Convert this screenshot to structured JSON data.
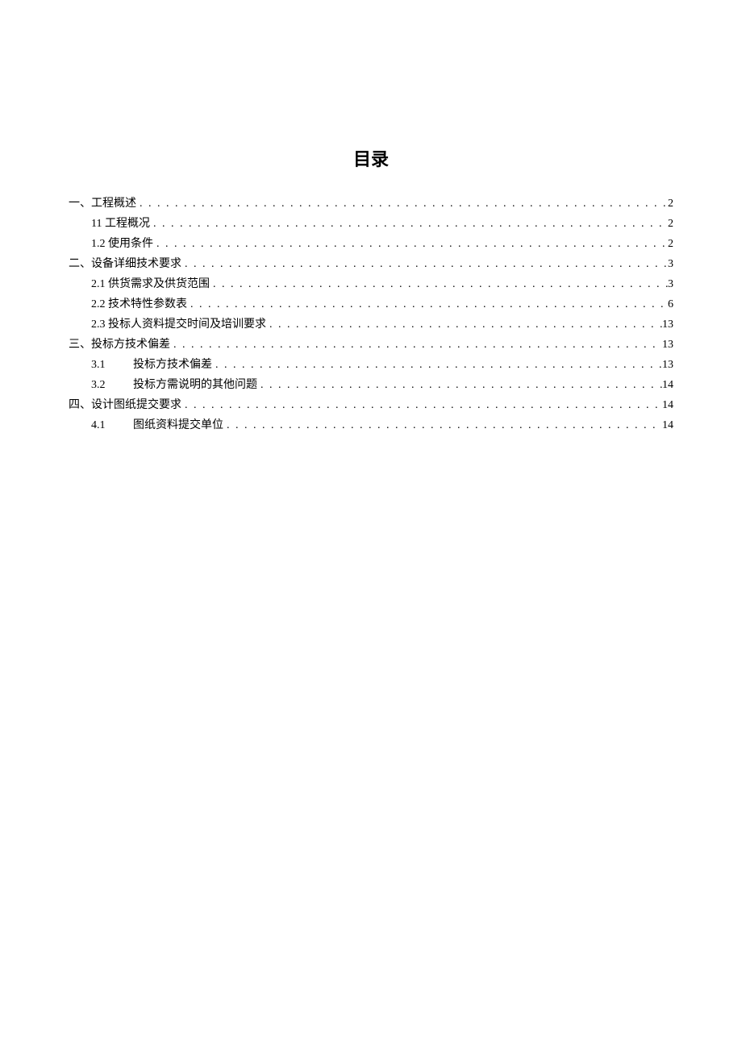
{
  "title": "目录",
  "toc": [
    {
      "level": 0,
      "label": "一、工程概述",
      "page": "2"
    },
    {
      "level": 1,
      "label": "11 工程概况",
      "page": "2"
    },
    {
      "level": 1,
      "label": "1.2 使用条件",
      "page": "2"
    },
    {
      "level": 0,
      "label": "二、设备详细技术要求",
      "page": "3"
    },
    {
      "level": 1,
      "label": "2.1 供货需求及供货范围",
      "page": "3"
    },
    {
      "level": 1,
      "label": "2.2 技术特性参数表",
      "page": "6"
    },
    {
      "level": 1,
      "label": "2.3 投标人资料提交时间及培训要求",
      "page": "13"
    },
    {
      "level": 0,
      "label": "三、投标方技术偏差",
      "page": "13"
    },
    {
      "level": 2,
      "num": "3.1",
      "label": "投标方技术偏差",
      "page": "13"
    },
    {
      "level": 2,
      "num": "3.2",
      "label": "投标方需说明的其他问题",
      "page": "14"
    },
    {
      "level": 0,
      "label": "四、设计图纸提交要求",
      "page": "14"
    },
    {
      "level": 2,
      "num": "4.1",
      "label": "图纸资料提交单位",
      "page": "14"
    }
  ]
}
